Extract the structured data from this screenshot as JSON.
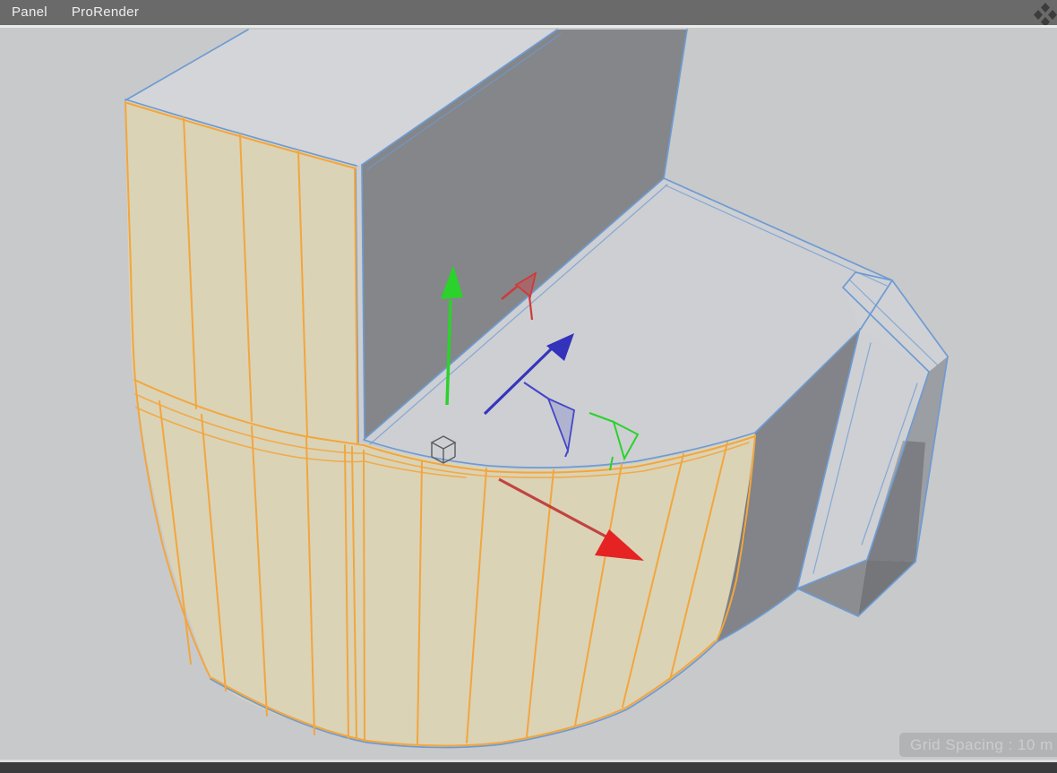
{
  "menu_bar": {
    "items": [
      {
        "label": "Panel"
      },
      {
        "label": "ProRender"
      }
    ],
    "layout_icon": "viewport-layout-diamonds-icon"
  },
  "viewport": {
    "hud": {
      "grid_spacing_label": "Grid Spacing : 10 m"
    },
    "active_tool": "move",
    "gizmo_axes": [
      {
        "axis": "x",
        "color": "#e52323"
      },
      {
        "axis": "y",
        "color": "#2bd22b"
      },
      {
        "axis": "z",
        "color": "#3535bd"
      }
    ],
    "selection": {
      "selected_face_fill": "#dbd3b6",
      "selected_edge_color": "#f2a63e"
    },
    "wireframe_color": "#6e9bd2",
    "object": "mug-polygon-mesh"
  },
  "colors": {
    "menu_bar_bg": "#6a6a6a",
    "menu_text": "#eeeeee",
    "viewport_bg": "#c8c9cb",
    "badge_bg": "#b2b3b4",
    "badge_text": "#cbcdce",
    "bottom_bar_bg": "#3a3a3c"
  }
}
